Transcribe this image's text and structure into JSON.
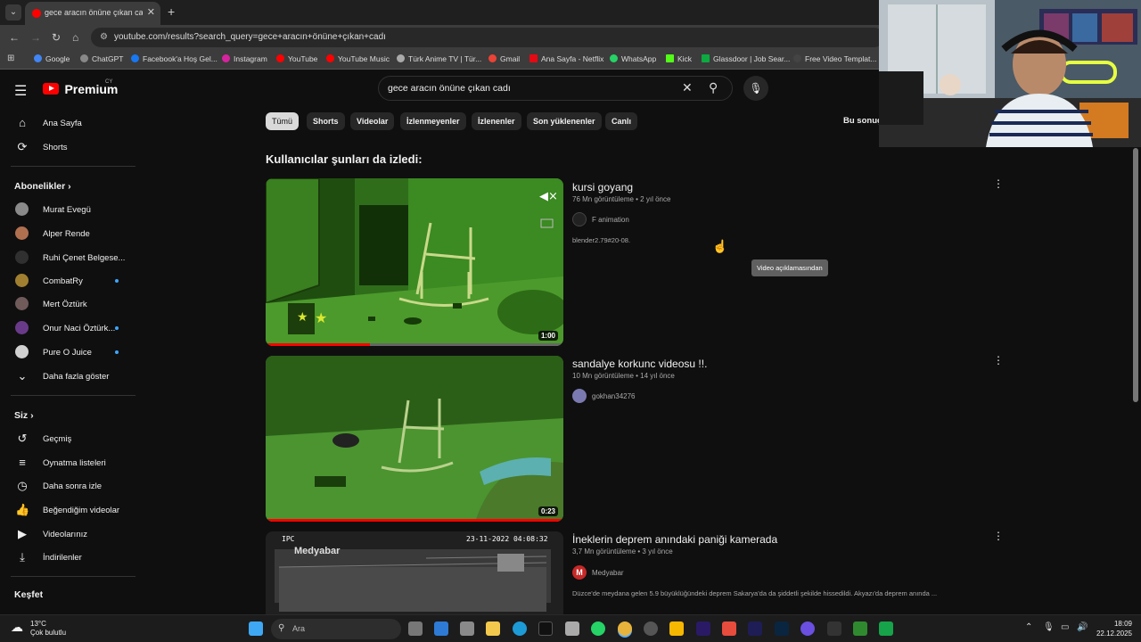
{
  "browser": {
    "tab_title": "gece aracın önüne çıkan cadı -",
    "url": "youtube.com/results?search_query=gece+aracın+önüne+çıkan+cadı",
    "bookmarks": [
      "Google",
      "ChatGPT",
      "Facebook'a Hoş Gel...",
      "Instagram",
      "YouTube",
      "YouTube Music",
      "Türk Anime TV | Tür...",
      "Gmail",
      "Ana Sayfa - Netflix",
      "WhatsApp",
      "Kick",
      "Glassdoor | Job Sear...",
      "Free Video Templat..."
    ]
  },
  "youtube": {
    "logo_text": "Premium",
    "logo_country": "CY",
    "search_query": "gece aracın önüne çıkan cadı",
    "chips": [
      "Tümü",
      "Shorts",
      "Videolar",
      "İzlenmeyenler",
      "İzlenenler",
      "Son yüklenenler",
      "Canlı"
    ],
    "filter_label": "Bu sonuç",
    "sidebar": {
      "main": [
        {
          "label": "Ana Sayfa",
          "icon": "home-icon"
        },
        {
          "label": "Shorts",
          "icon": "shorts-icon"
        }
      ],
      "subscriptions_header": "Abonelikler",
      "subscriptions": [
        {
          "label": "Murat Evegü",
          "color": "#8a8a8a",
          "dot": false
        },
        {
          "label": "Alper Rende",
          "color": "#b07050",
          "dot": false
        },
        {
          "label": "Ruhi Çenet Belgese...",
          "color": "#303030",
          "dot": false
        },
        {
          "label": "CombatRy",
          "color": "#a08030",
          "dot": true
        },
        {
          "label": "Mert Öztürk",
          "color": "#705a5a",
          "dot": false
        },
        {
          "label": "Onur Naci Öztürk...",
          "color": "#6a3a8a",
          "dot": true
        },
        {
          "label": "Pure O Juice",
          "color": "#d0d0d0",
          "dot": true
        }
      ],
      "show_more": "Daha fazla göster",
      "you_header": "Siz",
      "you": [
        {
          "label": "Geçmiş",
          "icon": "history-icon"
        },
        {
          "label": "Oynatma listeleri",
          "icon": "playlists-icon"
        },
        {
          "label": "Daha sonra izle",
          "icon": "watch-later-icon"
        },
        {
          "label": "Beğendiğim videolar",
          "icon": "like-icon"
        },
        {
          "label": "Videolarınız",
          "icon": "your-videos-icon"
        },
        {
          "label": "İndirilenler",
          "icon": "download-icon"
        }
      ],
      "explore_header": "Keşfet"
    },
    "section_title": "Kullanıcılar şunları da izledi:",
    "videos": [
      {
        "title": "kursi goyang",
        "meta": "76 Mn görüntüleme • 2 yıl önce",
        "channel": "F animation",
        "description": "blender2.79#20-08.",
        "duration": "1:00",
        "progress": 0.35
      },
      {
        "title": "sandalye korkunc videosu !!.",
        "meta": "10 Mn görüntüleme • 14 yıl önce",
        "channel": "gokhan34276",
        "description": "",
        "duration": "0:23",
        "progress": 1.0
      },
      {
        "title": "İneklerin deprem anındaki paniği kamerada",
        "meta": "3,7 Mn görüntüleme • 3 yıl önce",
        "channel": "Medyabar",
        "description": "Düzce'de meydana gelen 5.9 büyüklüğündeki deprem Sakarya'da da şiddetli şekilde hissedildi. Akyazı'da deprem anında ...",
        "duration": "",
        "cam_label": "IPC",
        "cam_brand": "Medyabar",
        "cam_time": "23-11-2022 04:08:32"
      }
    ],
    "tooltip": "Video açıklamasından"
  },
  "taskbar": {
    "temperature": "13°C",
    "weather": "Çok bulutlu",
    "search_placeholder": "Ara",
    "time": "18:09",
    "date": "22.12.2025"
  }
}
